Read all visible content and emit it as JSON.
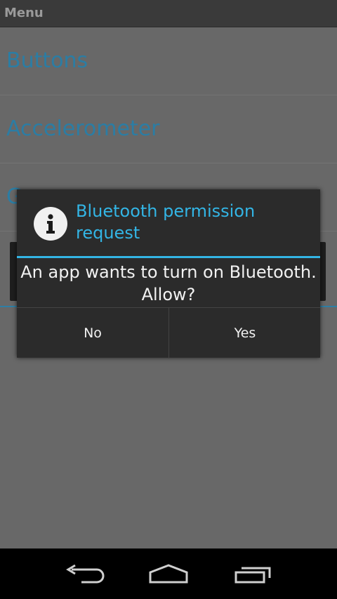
{
  "app": {
    "title": "Menu"
  },
  "menu": {
    "items": [
      {
        "label": "Buttons"
      },
      {
        "label": "Accelerometer"
      },
      {
        "label": "G"
      }
    ]
  },
  "dialog": {
    "icon": "info-icon",
    "title": "Bluetooth permission request",
    "message": "An app wants to turn on Bluetooth. Allow?",
    "buttons": {
      "no": "No",
      "yes": "Yes"
    }
  },
  "navbar": {
    "icons": [
      "back-icon",
      "home-icon",
      "recent-apps-icon"
    ]
  },
  "colors": {
    "accent": "#33b5e5",
    "list_text": "#2b7da4",
    "dialog_bg": "#2b2b2b"
  }
}
